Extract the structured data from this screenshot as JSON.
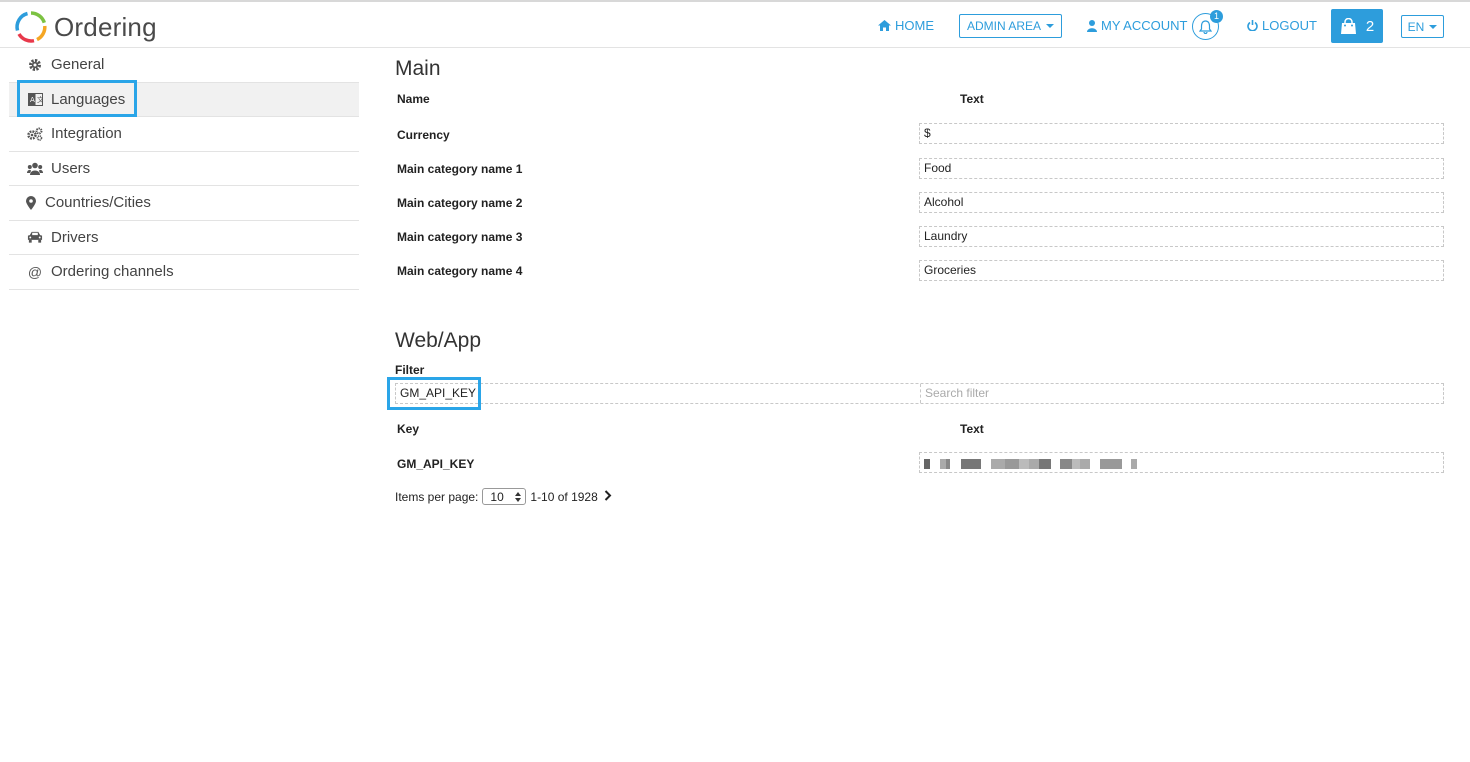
{
  "header": {
    "logo_text": "Ordering",
    "home": "HOME",
    "admin_area": "ADMIN AREA",
    "my_account": "MY ACCOUNT",
    "notification_count": "1",
    "logout": "LOGOUT",
    "cart_count": "2",
    "language": "EN"
  },
  "sidebar": {
    "items": [
      {
        "label": "General",
        "icon": "gear-icon"
      },
      {
        "label": "Languages",
        "icon": "language-icon"
      },
      {
        "label": "Integration",
        "icon": "gears-icon"
      },
      {
        "label": "Users",
        "icon": "users-icon"
      },
      {
        "label": "Countries/Cities",
        "icon": "map-marker-icon"
      },
      {
        "label": "Drivers",
        "icon": "car-icon"
      },
      {
        "label": "Ordering channels",
        "icon": "at-icon"
      }
    ],
    "active": "Languages"
  },
  "main": {
    "title": "Main",
    "col_name": "Name",
    "col_text": "Text",
    "rows": [
      {
        "label": "Currency",
        "value": "$"
      },
      {
        "label": "Main category name 1",
        "value": "Food"
      },
      {
        "label": "Main category name 2",
        "value": "Alcohol"
      },
      {
        "label": "Main category name 3",
        "value": "Laundry"
      },
      {
        "label": "Main category name 4",
        "value": "Groceries"
      }
    ]
  },
  "webapp": {
    "title": "Web/App",
    "filter_label": "Filter",
    "filter_key_value": "GM_API_KEY",
    "filter_text_placeholder": "Search filter",
    "col_key": "Key",
    "col_text": "Text",
    "rows": [
      {
        "key": "GM_API_KEY"
      }
    ]
  },
  "pager": {
    "items_per_page_label": "Items per page:",
    "per_page": "10",
    "range": "1-10 of 1928"
  },
  "colors": {
    "accent": "#2d9ddc",
    "highlight": "#2aa5e8"
  }
}
